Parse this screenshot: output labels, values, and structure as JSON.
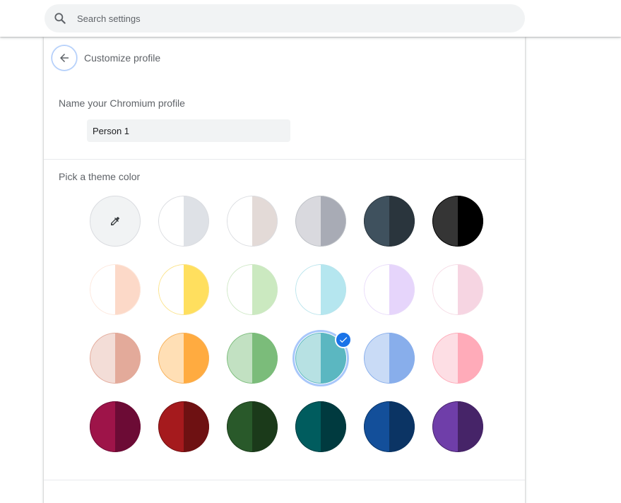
{
  "search": {
    "placeholder": "Search settings",
    "icon": "search-icon"
  },
  "header": {
    "title": "Customize profile",
    "back_icon": "arrow-back-icon"
  },
  "name_section": {
    "label": "Name your Chromium profile",
    "value": "Person 1"
  },
  "theme_section": {
    "label": "Pick a theme color",
    "custom_picker_icon": "eyedropper-icon",
    "selected_index": 14,
    "swatches": [
      {
        "id": "default",
        "left": "#ffffff",
        "right": "#dee1e6",
        "ring": "#dadce0"
      },
      {
        "id": "warm-grey",
        "left": "#ffffff",
        "right": "#e3dad7",
        "ring": "#dadce0"
      },
      {
        "id": "grey",
        "left": "#d9d9de",
        "right": "#a8abb5",
        "ring": "#bdc1c6"
      },
      {
        "id": "blue-grey",
        "left": "#3f515e",
        "right": "#2a353d",
        "ring": "#2a353d"
      },
      {
        "id": "black",
        "left": "#353535",
        "right": "#000000",
        "ring": "#000000"
      },
      {
        "id": "beige",
        "left": "#ffffff",
        "right": "#fcd9c8",
        "ring": "#fde7dc"
      },
      {
        "id": "yellow",
        "left": "#ffffff",
        "right": "#ffdf5e",
        "ring": "#fbe38a"
      },
      {
        "id": "green-light",
        "left": "#ffffff",
        "right": "#cbe9c0",
        "ring": "#cfe8c6"
      },
      {
        "id": "aqua",
        "left": "#ffffff",
        "right": "#b5e6ef",
        "ring": "#b9e4ec"
      },
      {
        "id": "violet-light",
        "left": "#ffffff",
        "right": "#e6d5fb",
        "ring": "#e8dbfa"
      },
      {
        "id": "pink-light",
        "left": "#ffffff",
        "right": "#f6d5e2",
        "ring": "#f5dbe5"
      },
      {
        "id": "peach",
        "left": "#f3ddd7",
        "right": "#e3aa9a",
        "ring": "#e3aa9a"
      },
      {
        "id": "orange",
        "left": "#ffdfb5",
        "right": "#ffab40",
        "ring": "#f7b15a"
      },
      {
        "id": "green",
        "left": "#c2e1c2",
        "right": "#7bbc7a",
        "ring": "#7bbc7a"
      },
      {
        "id": "teal",
        "left": "#b7e1e3",
        "right": "#5bb7c1",
        "ring": "#5bb7c1"
      },
      {
        "id": "blue",
        "left": "#c9dbf6",
        "right": "#88aeeb",
        "ring": "#88aeeb"
      },
      {
        "id": "pink",
        "left": "#fddee4",
        "right": "#ffabb9",
        "ring": "#ffabb9"
      },
      {
        "id": "magenta",
        "left": "#9e1449",
        "right": "#6c0b35",
        "ring": "#6c0b35"
      },
      {
        "id": "red",
        "left": "#a51a1d",
        "right": "#6e1112",
        "ring": "#6e1112"
      },
      {
        "id": "dark-green",
        "left": "#29592a",
        "right": "#1b3a1a",
        "ring": "#1b3a1a"
      },
      {
        "id": "dark-teal",
        "left": "#005c5e",
        "right": "#003a3f",
        "ring": "#003a3f"
      },
      {
        "id": "dark-blue",
        "left": "#134f9a",
        "right": "#0b3464",
        "ring": "#0b3464"
      },
      {
        "id": "purple",
        "left": "#6f3ea9",
        "right": "#462468",
        "ring": "#462468"
      }
    ]
  }
}
